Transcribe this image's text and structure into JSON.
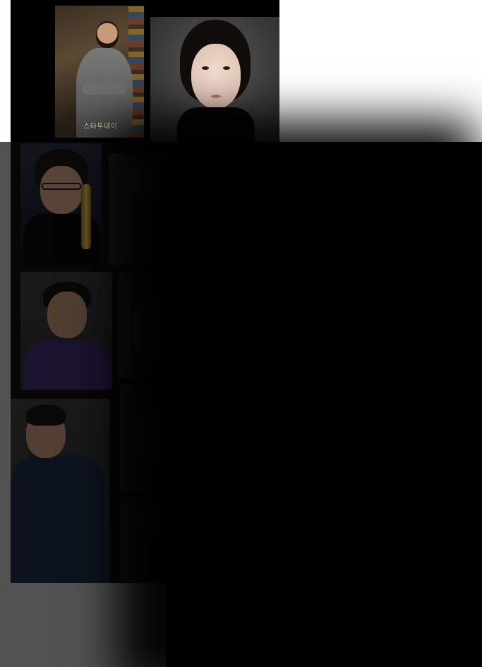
{
  "top_strip": {
    "images": [
      {
        "name": "suit-portrait",
        "overlay_text": "스타투데이"
      },
      {
        "name": "turtleneck-portrait"
      }
    ]
  },
  "gallery": {
    "images": [
      {
        "name": "oscar-portrait"
      },
      {
        "name": "dimmed-portrait-1"
      },
      {
        "name": "purple-shirt-portrait"
      },
      {
        "name": "dimmed-portrait-2"
      },
      {
        "name": "sweater-portrait"
      },
      {
        "name": "dimmed-portrait-3"
      },
      {
        "name": "dimmed-portrait-4"
      }
    ]
  },
  "colors": {
    "overlay": "#000000",
    "backdrop": "#b5b5b5",
    "page": "#ffffff"
  }
}
